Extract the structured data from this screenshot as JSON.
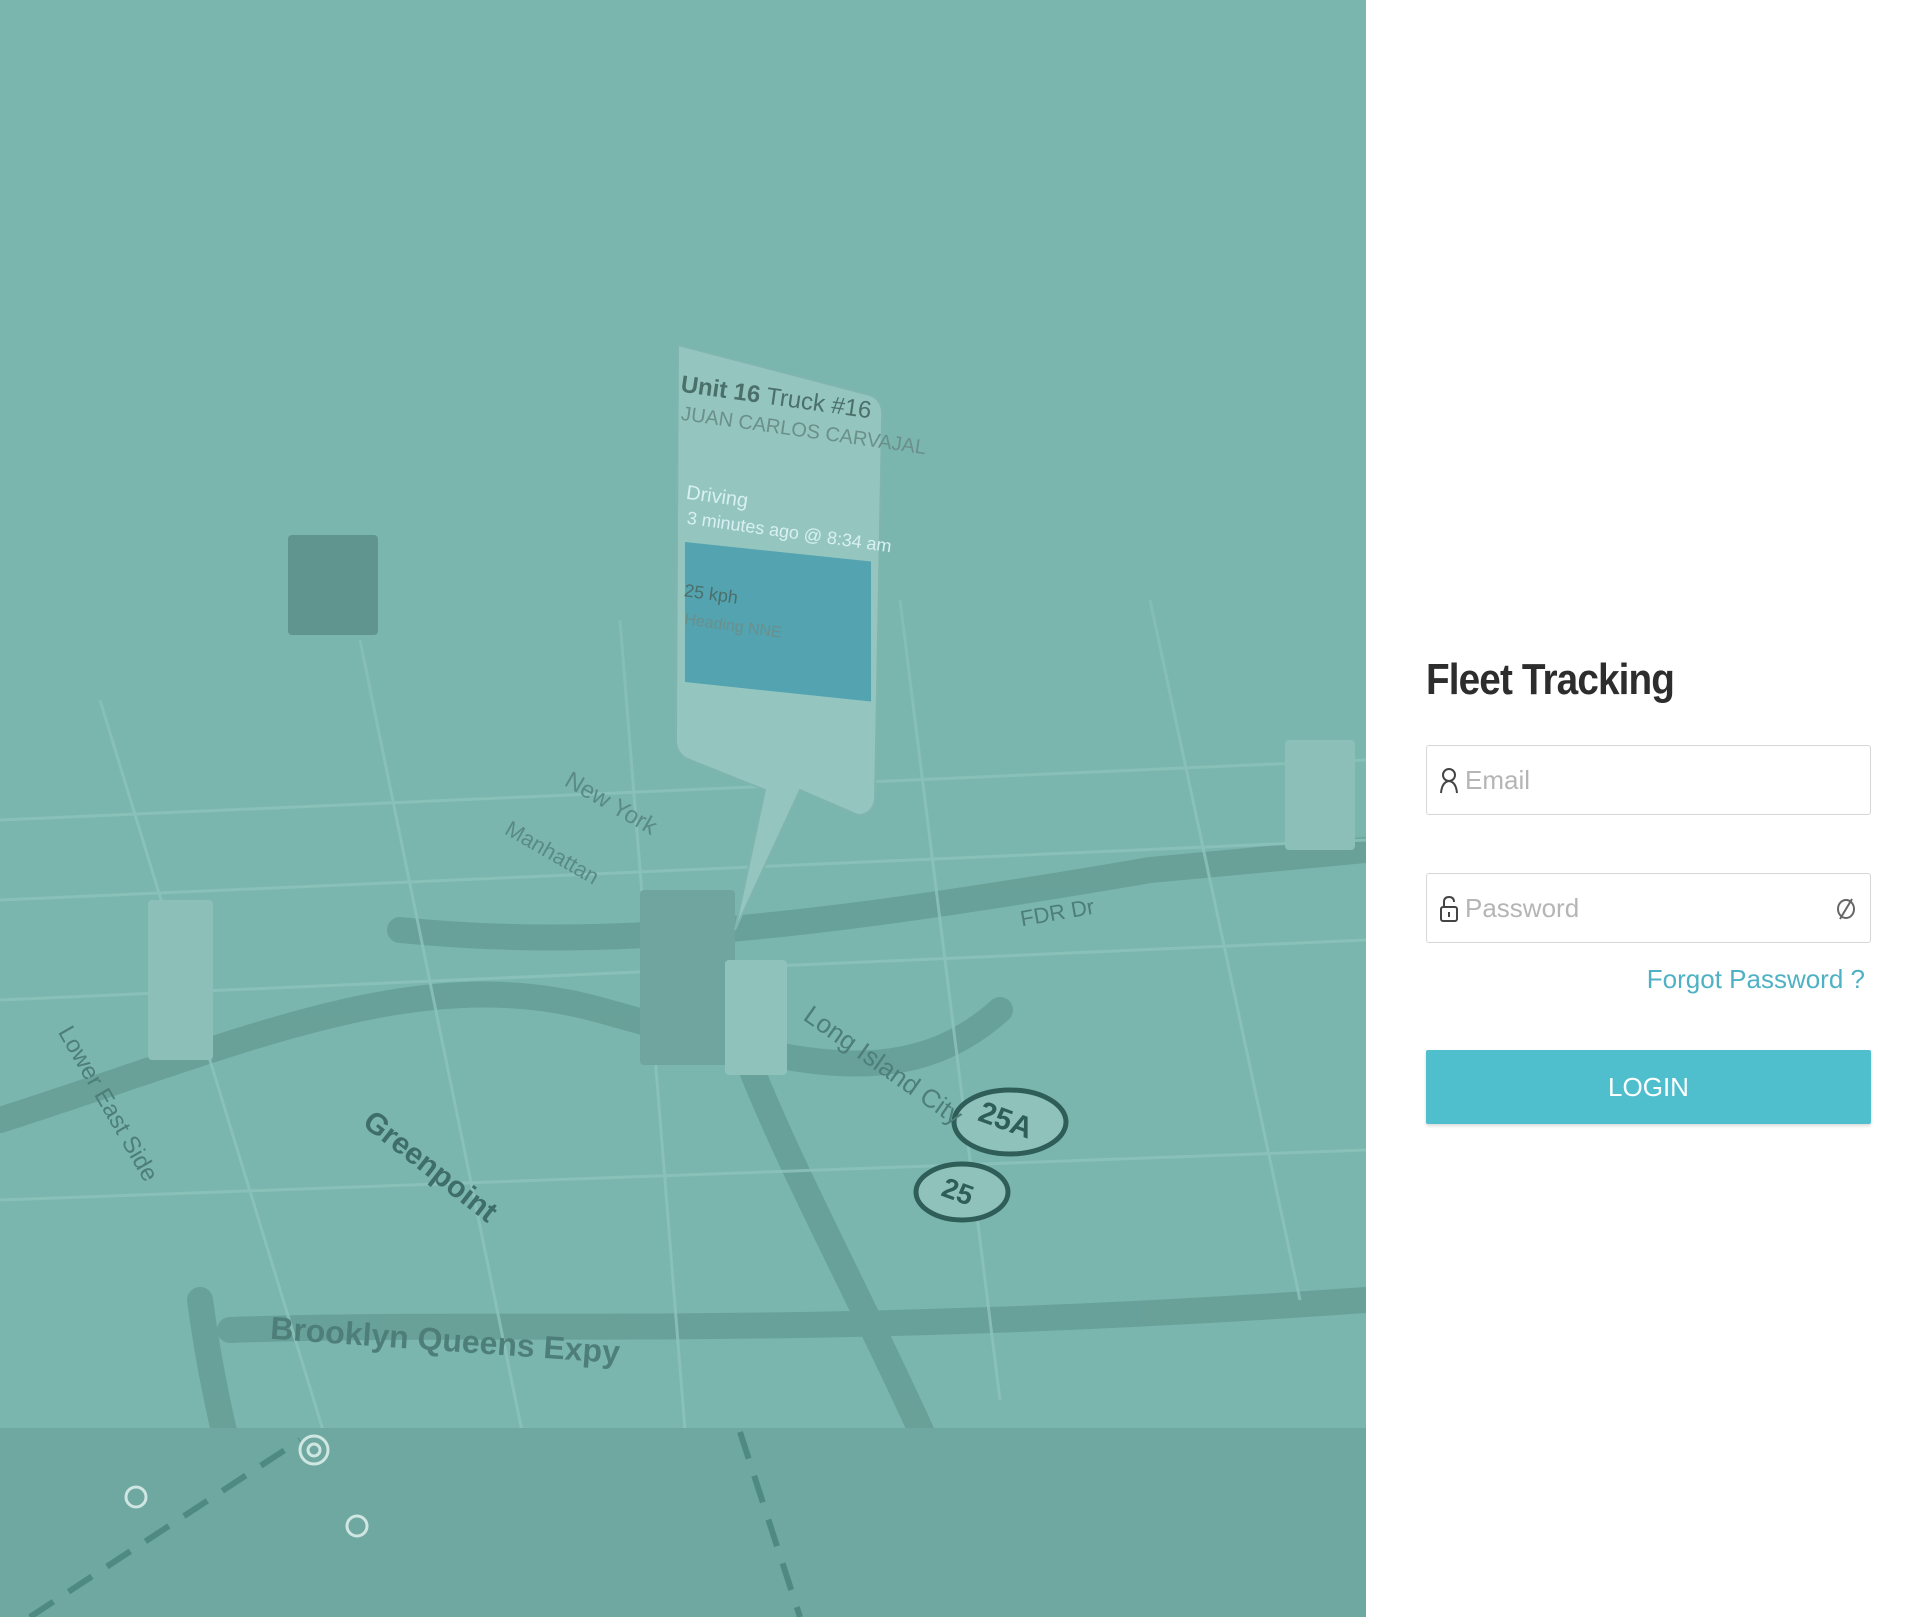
{
  "login": {
    "title": "Fleet Tracking",
    "email_placeholder": "Email",
    "password_placeholder": "Password",
    "forgot_label": "Forgot Password ?",
    "login_label": "LOGIN"
  },
  "hero": {
    "popup": {
      "unit": "Unit 16",
      "truck": "Truck #16",
      "driver": "JUAN CARLOS CARVAJAL",
      "status": "Driving",
      "status_time": "3 minutes ago @ 8:34 am",
      "speed": "25 kph",
      "heading": "Heading NNE"
    },
    "map_labels": {
      "greenpoint": "Greenpoint",
      "bqe": "Brooklyn Queens Expy",
      "long_island": "Long Island City",
      "route_25a": "25A",
      "route_25": "25",
      "fdr": "FDR Dr",
      "lower_east_side": "Lower East Side",
      "new_york": "New York",
      "manhattan": "Manhattan"
    }
  },
  "colors": {
    "hero_tint": "#7bb8b0",
    "accent": "#4fbfce",
    "link": "#4fb2c4",
    "title": "#2d2d2d"
  }
}
